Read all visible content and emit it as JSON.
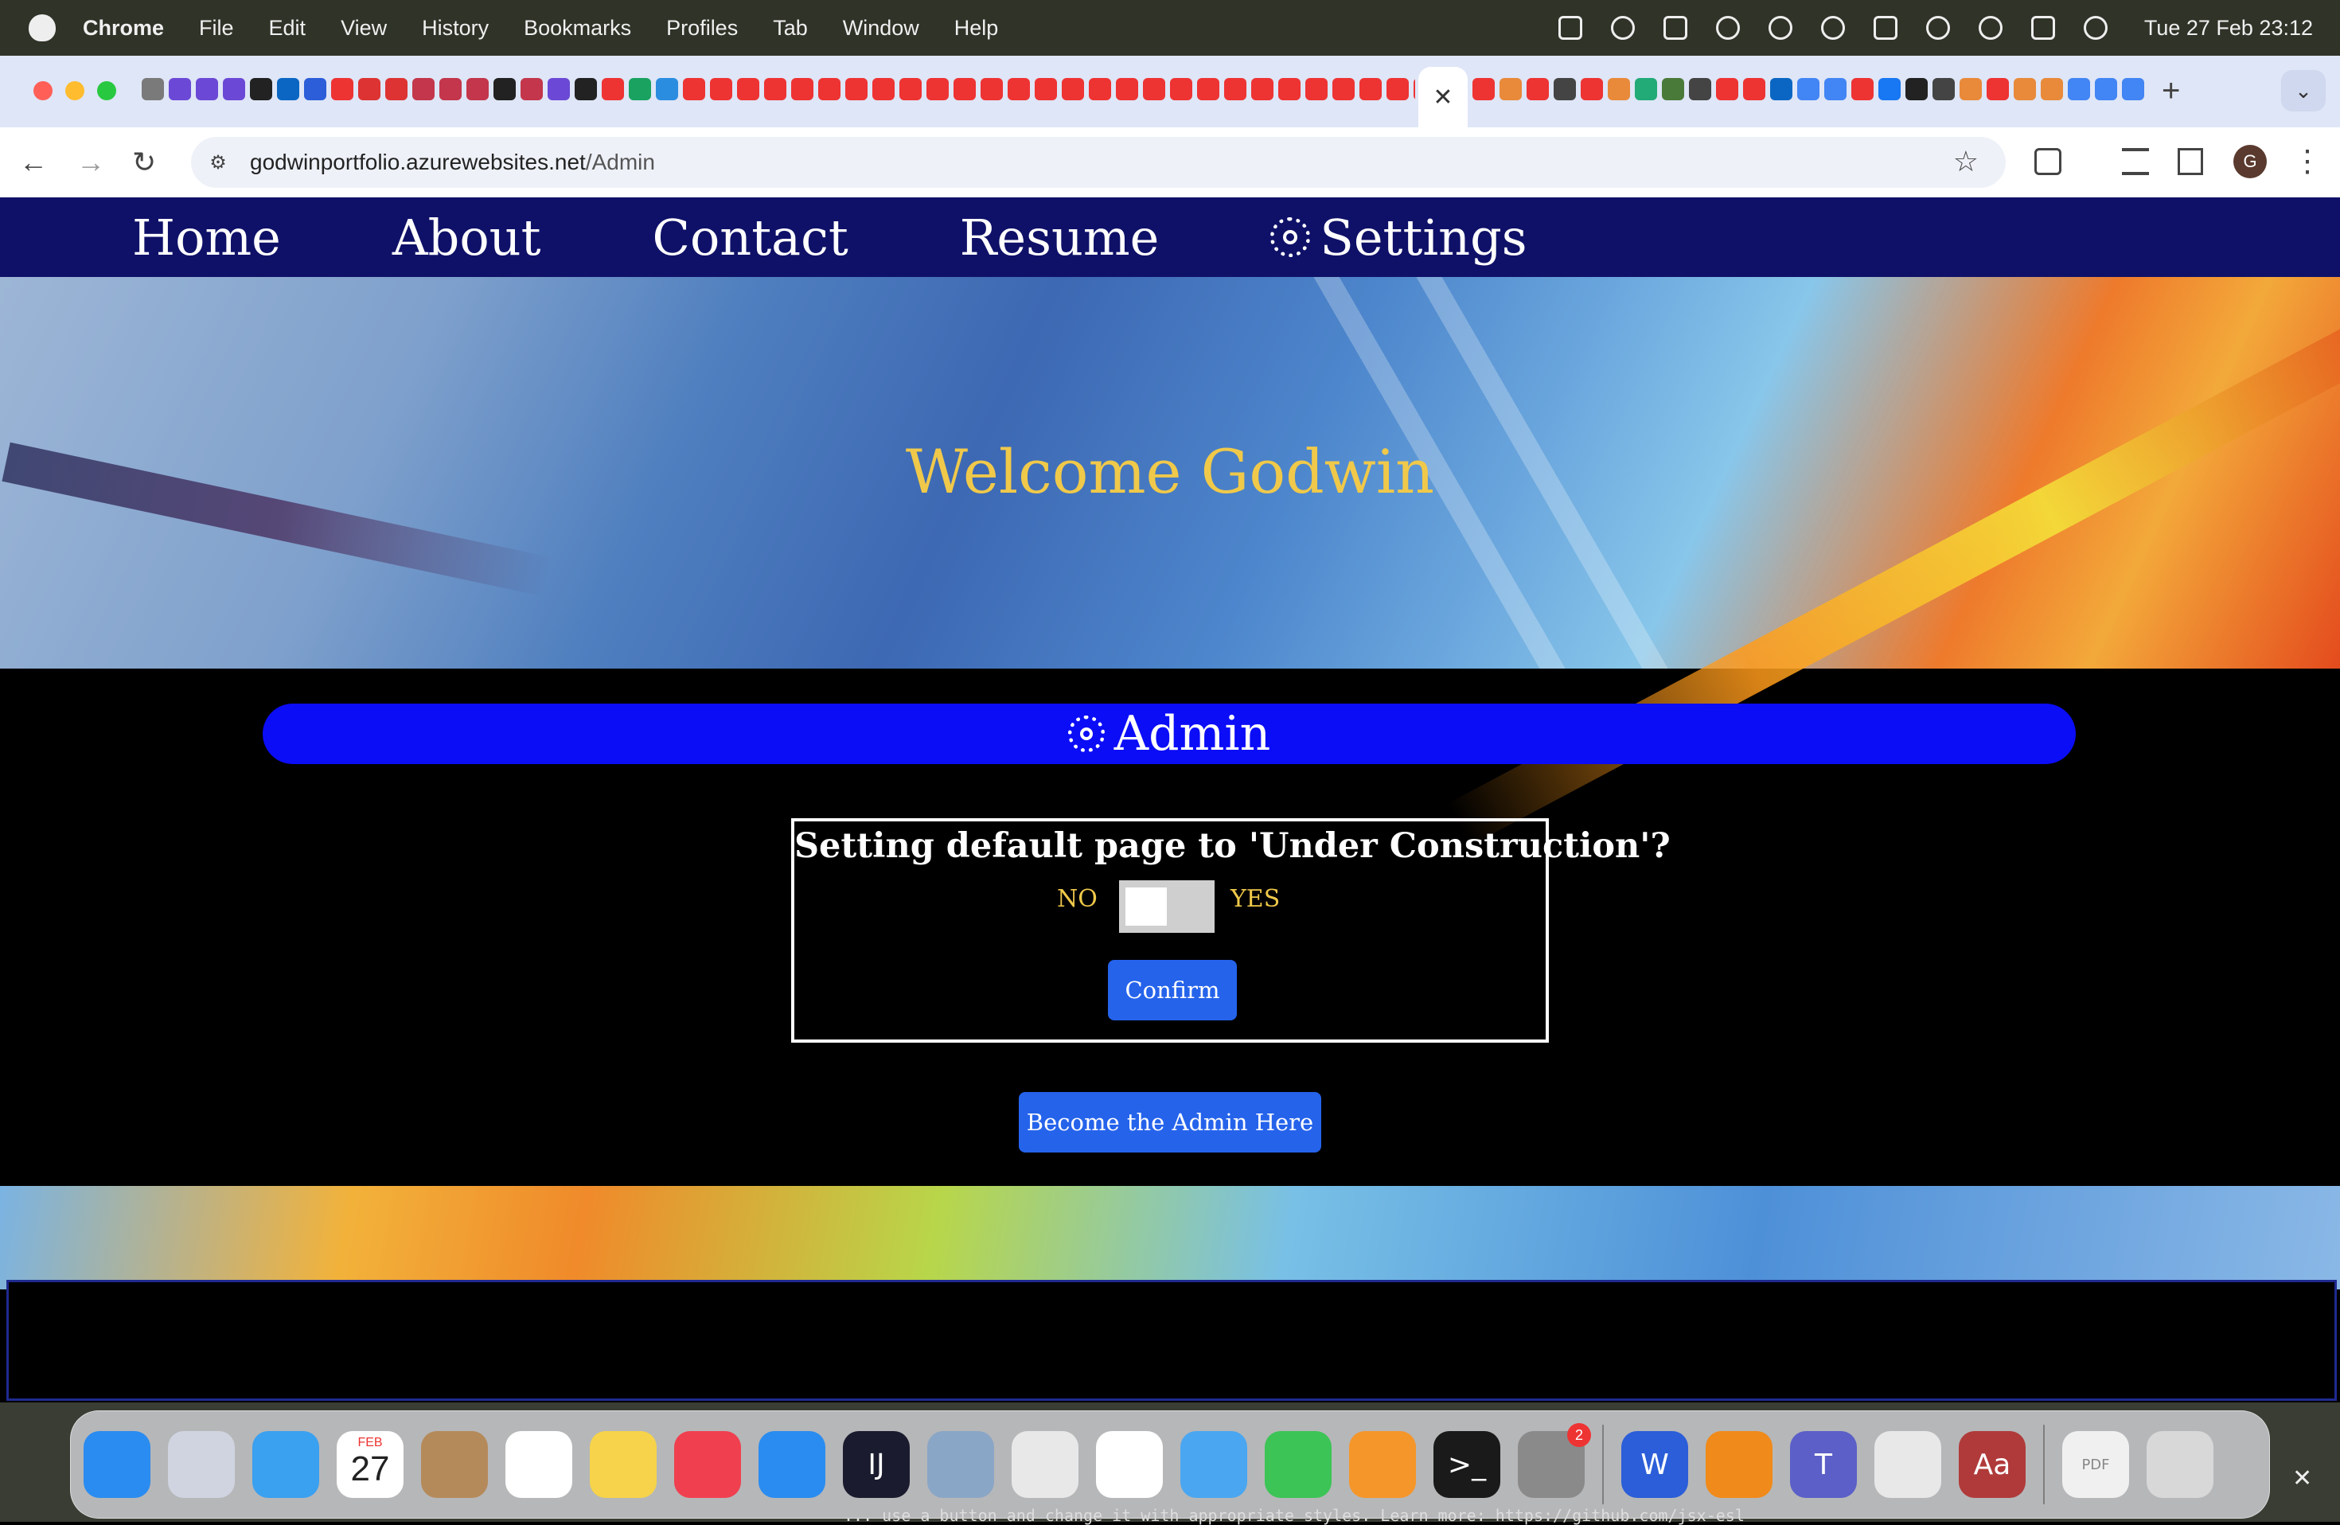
{
  "menubar": {
    "app_name": "Chrome",
    "items": [
      "File",
      "Edit",
      "View",
      "History",
      "Bookmarks",
      "Profiles",
      "Tab",
      "Window",
      "Help"
    ],
    "clock": "Tue 27 Feb  23:12"
  },
  "browser": {
    "active_tab_close": "✕",
    "new_tab": "+",
    "url_domain": "godwinportfolio.azurewebsites.net",
    "url_path": "/Admin",
    "profile_initial": "G",
    "favicon_colors_left": [
      "#7a7a7a",
      "#6b49d6",
      "#6b49d6",
      "#6b49d6",
      "#222",
      "#0a66c2",
      "#2b5ed8",
      "#e33",
      "#d33",
      "#d33",
      "#c3364b",
      "#c3364b",
      "#c3364b",
      "#222",
      "#c3364b",
      "#6b49d6",
      "#222",
      "#e33",
      "#1aa260",
      "#2b8de0",
      "#e33",
      "#e33",
      "#e33",
      "#e33",
      "#e33",
      "#e33",
      "#e33",
      "#e33",
      "#e33",
      "#e33",
      "#e33",
      "#e33",
      "#e33",
      "#e33",
      "#e33",
      "#e33",
      "#e33",
      "#e33",
      "#e33",
      "#e33",
      "#e33",
      "#e33",
      "#e33",
      "#e33",
      "#e33",
      "#e33",
      "#e33",
      "#e33",
      "#e33",
      "#4bb4e6",
      "#e33",
      "#3b9",
      "#e8a",
      "#7a7",
      "#4a4a4a",
      "#2b5ed8",
      "#222",
      "#222",
      "#222"
    ],
    "favicon_colors_right": [
      "#e33",
      "#e88a3a",
      "#e33",
      "#444",
      "#e33",
      "#e88a3a",
      "#2a7",
      "#4a7a3a",
      "#444",
      "#e33",
      "#e33",
      "#0a66c2",
      "#4285f4",
      "#4285f4",
      "#e33",
      "#1877f2",
      "#222",
      "#444",
      "#e88a3a",
      "#e33",
      "#e88a3a",
      "#e88a3a",
      "#4285f4",
      "#4285f4",
      "#4285f4",
      "#444"
    ]
  },
  "site": {
    "nav": [
      "Home",
      "About",
      "Contact",
      "Resume",
      "Settings"
    ],
    "welcome": "Welcome Godwin",
    "admin_title": "Admin",
    "setting_question": "Setting default page to 'Under Construction'?",
    "toggle_no": "NO",
    "toggle_yes": "YES",
    "toggle_state": "off",
    "confirm_label": "Confirm",
    "become_admin_label": "Become the Admin Here"
  },
  "dock": {
    "calendar_month": "FEB",
    "calendar_day": "27",
    "settings_badge": "2",
    "apps": [
      {
        "name": "finder",
        "color": "#2a8cf0"
      },
      {
        "name": "launchpad",
        "color": "#d0d4e0"
      },
      {
        "name": "mail",
        "color": "#3aa0f0"
      },
      {
        "name": "calendar",
        "color": "#ffffff"
      },
      {
        "name": "contacts",
        "color": "#b58a5a"
      },
      {
        "name": "reminders",
        "color": "#ffffff"
      },
      {
        "name": "notes",
        "color": "#f6d34a"
      },
      {
        "name": "news",
        "color": "#f04050"
      },
      {
        "name": "keynote",
        "color": "#2a8cf0"
      },
      {
        "name": "intellij",
        "color": "#1b1b2f"
      },
      {
        "name": "preview",
        "color": "#8aa6c6"
      },
      {
        "name": "chrome",
        "color": "#e8e8e8"
      },
      {
        "name": "vscode",
        "color": "#ffffff"
      },
      {
        "name": "safari",
        "color": "#4aa6f0"
      },
      {
        "name": "numbers",
        "color": "#3cc456"
      },
      {
        "name": "pages",
        "color": "#f5962a"
      },
      {
        "name": "terminal",
        "color": "#1a1a1a"
      },
      {
        "name": "system-settings",
        "color": "#8a8a8a"
      },
      {
        "name": "word",
        "color": "#2b5ed8"
      },
      {
        "name": "vlc",
        "color": "#f08a1a"
      },
      {
        "name": "teams",
        "color": "#5b5fc7"
      },
      {
        "name": "whatsapp",
        "color": "#e8e8e8"
      },
      {
        "name": "dictionary",
        "color": "#b03a3a"
      },
      {
        "name": "pdf-document",
        "color": "#f0f0f0"
      },
      {
        "name": "trash",
        "color": "#d8d8d8"
      }
    ],
    "dictionary_label": "Aa",
    "word_label": "W",
    "intellij_label": "IJ",
    "terminal_label": ">_",
    "teams_label": "T",
    "pdf_label": "PDF"
  },
  "status_text": "... use a button and change it with appropriate styles. Learn more: https://github.com/jsx-esl"
}
